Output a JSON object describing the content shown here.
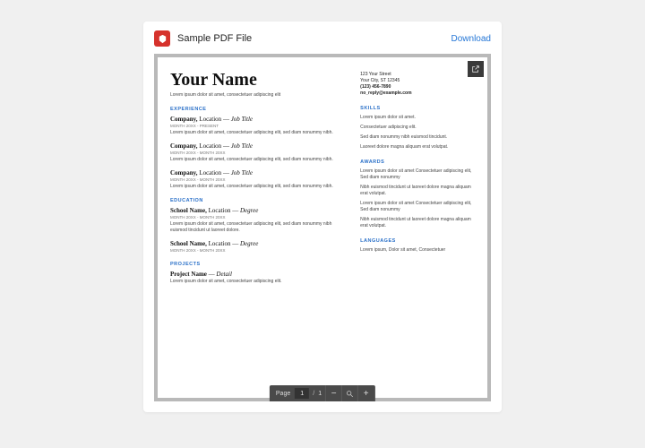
{
  "header": {
    "file_title": "Sample PDF File",
    "download": "Download"
  },
  "resume": {
    "name": "Your Name",
    "subtitle": "Lorem ipsum dolor sit amet, consectetuer adipiscing elit",
    "contact": {
      "street": "123 Your Street",
      "citystate": "Your City, ST 12345",
      "phone": "(123) 456-7890",
      "email": "no_reply@example.com"
    },
    "left": {
      "experience_h": "EXPERIENCE",
      "jobs": [
        {
          "company": "Company,",
          "location": " Location",
          "dash": " — ",
          "role": "Job Title",
          "dates": "MONTH 20XX - PRESENT",
          "desc": "Lorem ipsum dolor sit amet, consectetuer adipiscing elit, sed diam nonummy nibh."
        },
        {
          "company": "Company,",
          "location": " Location",
          "dash": " — ",
          "role": "Job Title",
          "dates": "MONTH 20XX - MONTH 20XX",
          "desc": "Lorem ipsum dolor sit amet, consectetuer adipiscing elit, sed diam nonummy nibh."
        },
        {
          "company": "Company,",
          "location": " Location",
          "dash": " — ",
          "role": "Job Title",
          "dates": "MONTH 20XX - MONTH 20XX",
          "desc": "Lorem ipsum dolor sit amet, consectetuer adipiscing elit, sed diam nonummy nibh."
        }
      ],
      "education_h": "EDUCATION",
      "schools": [
        {
          "company": "School Name,",
          "location": " Location",
          "dash": " — ",
          "role": "Degree",
          "dates": "MONTH 20XX - MONTH 20XX",
          "desc": "Lorem ipsum dolor sit amet, consectetuer adipiscing elit, sed diam nonummy nibh euismod tincidunt ut laoreet dolore."
        },
        {
          "company": "School Name,",
          "location": " Location",
          "dash": " — ",
          "role": "Degree",
          "dates": "MONTH 20XX - MONTH 20XX",
          "desc": ""
        }
      ],
      "projects_h": "PROJECTS",
      "projects": [
        {
          "company": "Project Name",
          "location": "",
          "dash": " — ",
          "role": "Detail",
          "dates": "",
          "desc": "Lorem ipsum dolor sit amet, consectetuer adipiscing elit."
        }
      ]
    },
    "right": {
      "skills_h": "SKILLS",
      "skills": [
        "Lorem ipsum dolor sit amet.",
        "Consectetuer adipiscing elit.",
        "Sed diam nonummy nibh euismod tincidunt.",
        "Laoreet dolore magna aliquam erat volutpat."
      ],
      "awards_h": "AWARDS",
      "awards": [
        "Lorem ipsum dolor sit amet Consectetuer adipiscing elit, Sed diam nonummy",
        "Nibh euismod tincidunt ut laoreet dolore magna aliquam erat volutpat.",
        "Lorem ipsum dolor sit amet Consectetuer adipiscing elit, Sed diam nonummy",
        "Nibh euismod tincidunt ut laoreet dolore magna aliquam erat volutpat."
      ],
      "languages_h": "LANGUAGES",
      "languages": "Lorem ipsum, Dolor sit amet, Consectetuer"
    }
  },
  "toolbar": {
    "page_label": "Page",
    "current": "1",
    "sep": "/",
    "total": "1"
  }
}
